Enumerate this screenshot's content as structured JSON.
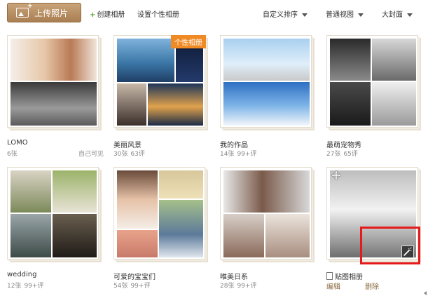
{
  "toolbar": {
    "upload_label": "上传照片",
    "create_label": "创建相册",
    "personal_label": "设置个性相册",
    "sort_label": "自定义排序",
    "view_label": "普通视图",
    "cover_label": "大封面"
  },
  "albums": [
    {
      "name": "LOMO",
      "count": "6张",
      "permission": "自己可见"
    },
    {
      "name": "美丽风景",
      "count": "30张",
      "comments": "63评",
      "badge": "个性相册"
    },
    {
      "name": "我的作品",
      "count": "14张",
      "comments": "99+评"
    },
    {
      "name": "最萌宠物秀",
      "count": "27张",
      "comments": "65评"
    },
    {
      "name": "wedding",
      "count": "12张",
      "comments": "99+评"
    },
    {
      "name": "可爱的宝宝们",
      "count": "54张",
      "comments": "99+评"
    },
    {
      "name": "唯美日系",
      "count": "28张",
      "comments": "99+评"
    }
  ],
  "sticker_album": {
    "label": "贴图相册",
    "edit_label": "编辑",
    "delete_label": "删除"
  },
  "colors": {
    "accent": "#a97f52",
    "badge": "#f08a24",
    "highlight": "#e51a1a",
    "create_plus": "#5aa02c"
  },
  "icons": [
    "upload-photo-icon",
    "plus-icon",
    "caret-down-icon",
    "move-icon",
    "magic-wand-icon",
    "checkbox-icon"
  ]
}
